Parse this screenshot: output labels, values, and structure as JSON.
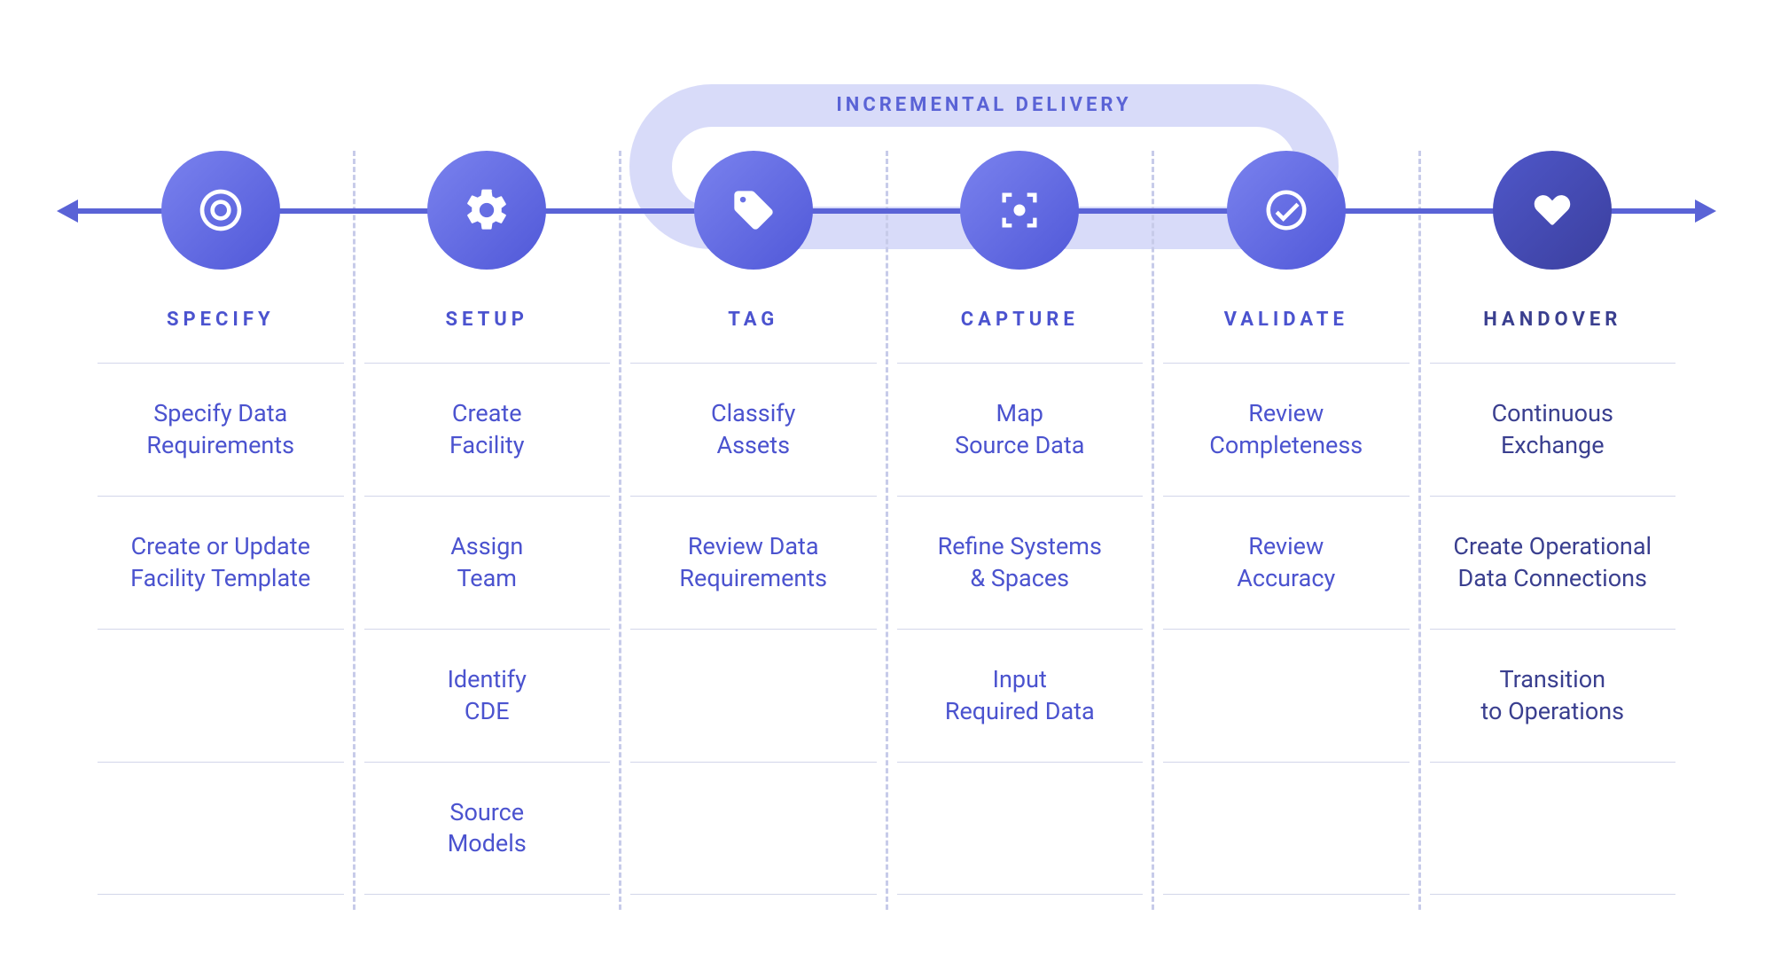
{
  "loop_label": "INCREMENTAL DELIVERY",
  "stages": [
    {
      "key": "specify",
      "title": "SPECIFY",
      "icon": "target-icon",
      "rows": [
        "Specify Data\nRequirements",
        "Create or Update\nFacility Template",
        "",
        ""
      ]
    },
    {
      "key": "setup",
      "title": "SETUP",
      "icon": "gear-icon",
      "rows": [
        "Create\nFacility",
        "Assign\nTeam",
        "Identify\nCDE",
        "Source\nModels"
      ]
    },
    {
      "key": "tag",
      "title": "TAG",
      "icon": "tag-icon",
      "rows": [
        "Classify\nAssets",
        "Review Data\nRequirements",
        "",
        ""
      ]
    },
    {
      "key": "capture",
      "title": "CAPTURE",
      "icon": "capture-icon",
      "rows": [
        "Map\nSource Data",
        "Refine Systems\n& Spaces",
        "Input\nRequired Data",
        ""
      ]
    },
    {
      "key": "validate",
      "title": "VALIDATE",
      "icon": "check-icon",
      "rows": [
        "Review\nCompleteness",
        "Review\nAccuracy",
        "",
        ""
      ]
    },
    {
      "key": "handover",
      "title": "HANDOVER",
      "icon": "handshake-icon",
      "rows": [
        "Continuous\nExchange",
        "Create Operational\nData Connections",
        "Transition\nto Operations",
        ""
      ]
    }
  ]
}
